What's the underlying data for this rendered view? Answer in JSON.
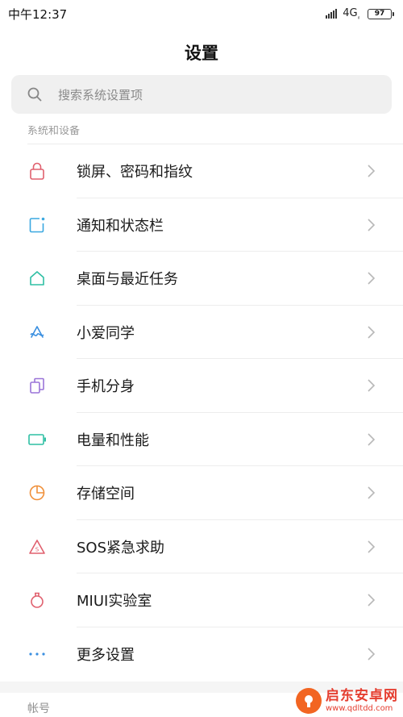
{
  "status_bar": {
    "time": "中午12:37",
    "network": "4G",
    "network_sub": "ᵢₗ",
    "battery": "97"
  },
  "header": {
    "title": "设置"
  },
  "search": {
    "placeholder": "搜索系统设置项"
  },
  "section": {
    "label": "系统和设备"
  },
  "items": [
    {
      "label": "锁屏、密码和指纹",
      "icon": "lock-icon",
      "color": "#e0606e"
    },
    {
      "label": "通知和状态栏",
      "icon": "notification-icon",
      "color": "#3aa8e0"
    },
    {
      "label": "桌面与最近任务",
      "icon": "home-icon",
      "color": "#2fbfa4"
    },
    {
      "label": "小爱同学",
      "icon": "xiaoai-icon",
      "color": "#3a8fe0"
    },
    {
      "label": "手机分身",
      "icon": "dual-phone-icon",
      "color": "#9a74d8"
    },
    {
      "label": "电量和性能",
      "icon": "battery-icon",
      "color": "#2fbfa4"
    },
    {
      "label": "存储空间",
      "icon": "storage-icon",
      "color": "#f0903a"
    },
    {
      "label": "SOS紧急求助",
      "icon": "sos-icon",
      "color": "#e0606e"
    },
    {
      "label": "MIUI实验室",
      "icon": "lab-flask-icon",
      "color": "#e0606e"
    },
    {
      "label": "更多设置",
      "icon": "more-dots-icon",
      "color": "#3a8fe0"
    }
  ],
  "account_section": {
    "label": "帐号"
  },
  "watermark": {
    "name": "启东安卓网",
    "url": "www.qdltdd.com"
  }
}
